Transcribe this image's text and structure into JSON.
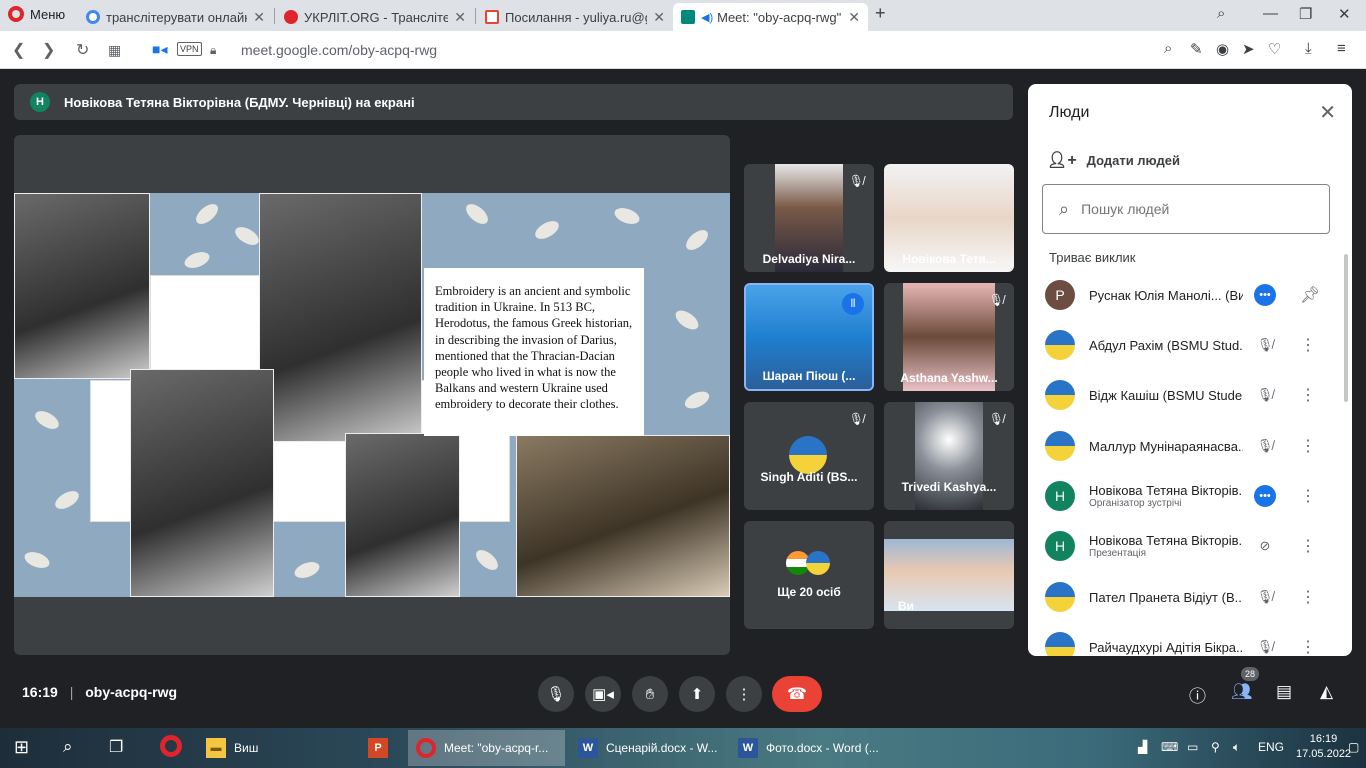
{
  "browser": {
    "menu_label": "Меню",
    "tabs": [
      {
        "title": "транслітерувати онлайн -",
        "color": "#4285f4"
      },
      {
        "title": "УКРЛІТ.ORG - Транслітера",
        "color": "#e0242b"
      },
      {
        "title": "Посилання - yuliya.ru@gm",
        "color": "#ea4335"
      },
      {
        "title": "Meet: \"oby-acpq-rwg\"",
        "color": "#00897b"
      }
    ],
    "url": "meet.google.com/oby-acpq-rwg",
    "vpn": "VPN"
  },
  "banner": {
    "initial": "Н",
    "text": "Новікова Тетяна Вікторівна (БДМУ. Чернівці) на екрані"
  },
  "slide": {
    "text": "Embroidery is an ancient and symbolic tradition in Ukraine. In 513 BC, Herodotus, the famous Greek  historian, in describing the invasion of Darius, mentioned that the Thracian-Dacian people who lived in what is now the Balkans and western Ukraine used embroidery to decorate their clothes."
  },
  "tiles": [
    {
      "name": "Delvadiya Nira..."
    },
    {
      "name": "Новікова Тетя..."
    },
    {
      "name": "Шаран Піюш (..."
    },
    {
      "name": "Asthana Yashw..."
    },
    {
      "name": "Singh Aditi (BS..."
    },
    {
      "name": "Trivedi Kashya..."
    },
    {
      "name": "Ще 20 осіб"
    },
    {
      "name": "Ви"
    }
  ],
  "people_panel": {
    "title": "Люди",
    "add_label": "Додати людей",
    "search_placeholder": "Пошук людей",
    "section": "Триває виклик",
    "rows": [
      {
        "initial": "Р",
        "name": "Руснак Юлія Манолі... (Ви)",
        "role": "",
        "color": "#6d4c41"
      },
      {
        "initial": "",
        "name": "Абдул Рахім (BSMU Stud...",
        "role": "",
        "color": ""
      },
      {
        "initial": "",
        "name": "Вiдж Кашiш (BSMU Stude...",
        "role": "",
        "color": ""
      },
      {
        "initial": "",
        "name": "Маллур Мунінараянасва...",
        "role": "",
        "color": ""
      },
      {
        "initial": "Н",
        "name": "Новікова Тетяна Вікторів...",
        "role": "Організатор зустрічі",
        "color": "#12835f"
      },
      {
        "initial": "Н",
        "name": "Новікова Тетяна Вікторів...",
        "role": "Презентація",
        "color": "#12835f"
      },
      {
        "initial": "",
        "name": "Пател Пранета Відіут (В...",
        "role": "",
        "color": ""
      },
      {
        "initial": "",
        "name": "Райчаудхурі Адітія Бікра...",
        "role": "",
        "color": ""
      }
    ]
  },
  "bottom": {
    "time": "16:19",
    "code": "oby-acpq-rwg",
    "people_count": "28"
  },
  "taskbar": {
    "items": [
      "Виш",
      "",
      "Meet: \"oby-acpq-r...",
      "Сценарій.docx - W...",
      "Фото.docx - Word (..."
    ],
    "lang": "ENG",
    "time": "16:19",
    "date": "17.05.2022"
  }
}
